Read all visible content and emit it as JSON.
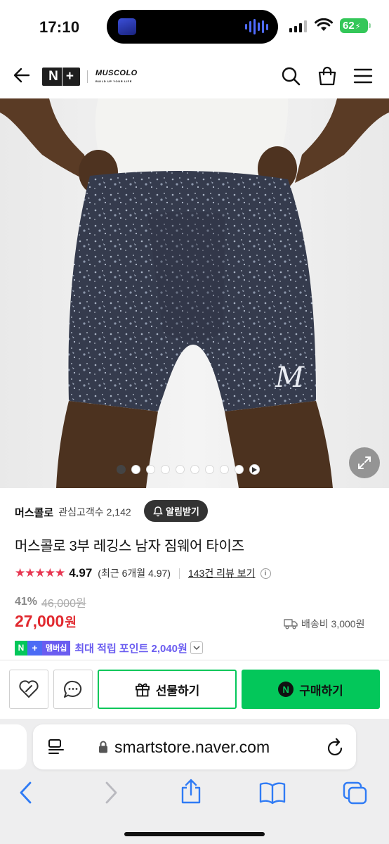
{
  "status_bar": {
    "time": "17:10",
    "battery": "62",
    "icons": [
      "now-playing-artwork",
      "audio-waveform-icon",
      "signal-icon",
      "wifi-icon",
      "battery-charging-icon"
    ]
  },
  "header": {
    "nplus_logo": "N+",
    "brand_logo": "MUSCOLO",
    "brand_tagline": "BUILD UP YOUR LIFE",
    "icons": [
      "back-arrow-icon",
      "search-icon",
      "shopping-bag-icon",
      "menu-icon"
    ]
  },
  "product_image": {
    "alt": "product-photo",
    "carousel_total": 10,
    "carousel_active": 1,
    "has_video_slide": true
  },
  "store": {
    "name": "머스콜로",
    "follower_label": "관심고객수",
    "follower_count": "2,142",
    "alarm_button": "알림받기"
  },
  "product": {
    "title": "머스콜로 3부 레깅스 남자 짐웨어 타이즈",
    "stars": "★★★★★",
    "rating": "4.97",
    "recent_rating": "(최근 6개월 4.97)",
    "review_link": "143건 리뷰 보기",
    "discount_rate": "41%",
    "original_price": "46,000원",
    "sale_price": "27,000",
    "price_unit": "원",
    "shipping": "배송비 3,000원"
  },
  "membership": {
    "badge_n": "N",
    "badge_plus": "+",
    "badge_label": "멤버십",
    "text": "최대 적립 포인트 2,040원"
  },
  "actions": {
    "gift_label": "선물하기",
    "buy_label": "구매하기",
    "buy_badge": "N"
  },
  "browser": {
    "url": "smartstore.naver.com"
  },
  "colors": {
    "naver_green": "#03c75a",
    "price_red": "#e1292f",
    "star_red": "#e73651",
    "membership_purple": "#6a5cf0"
  }
}
